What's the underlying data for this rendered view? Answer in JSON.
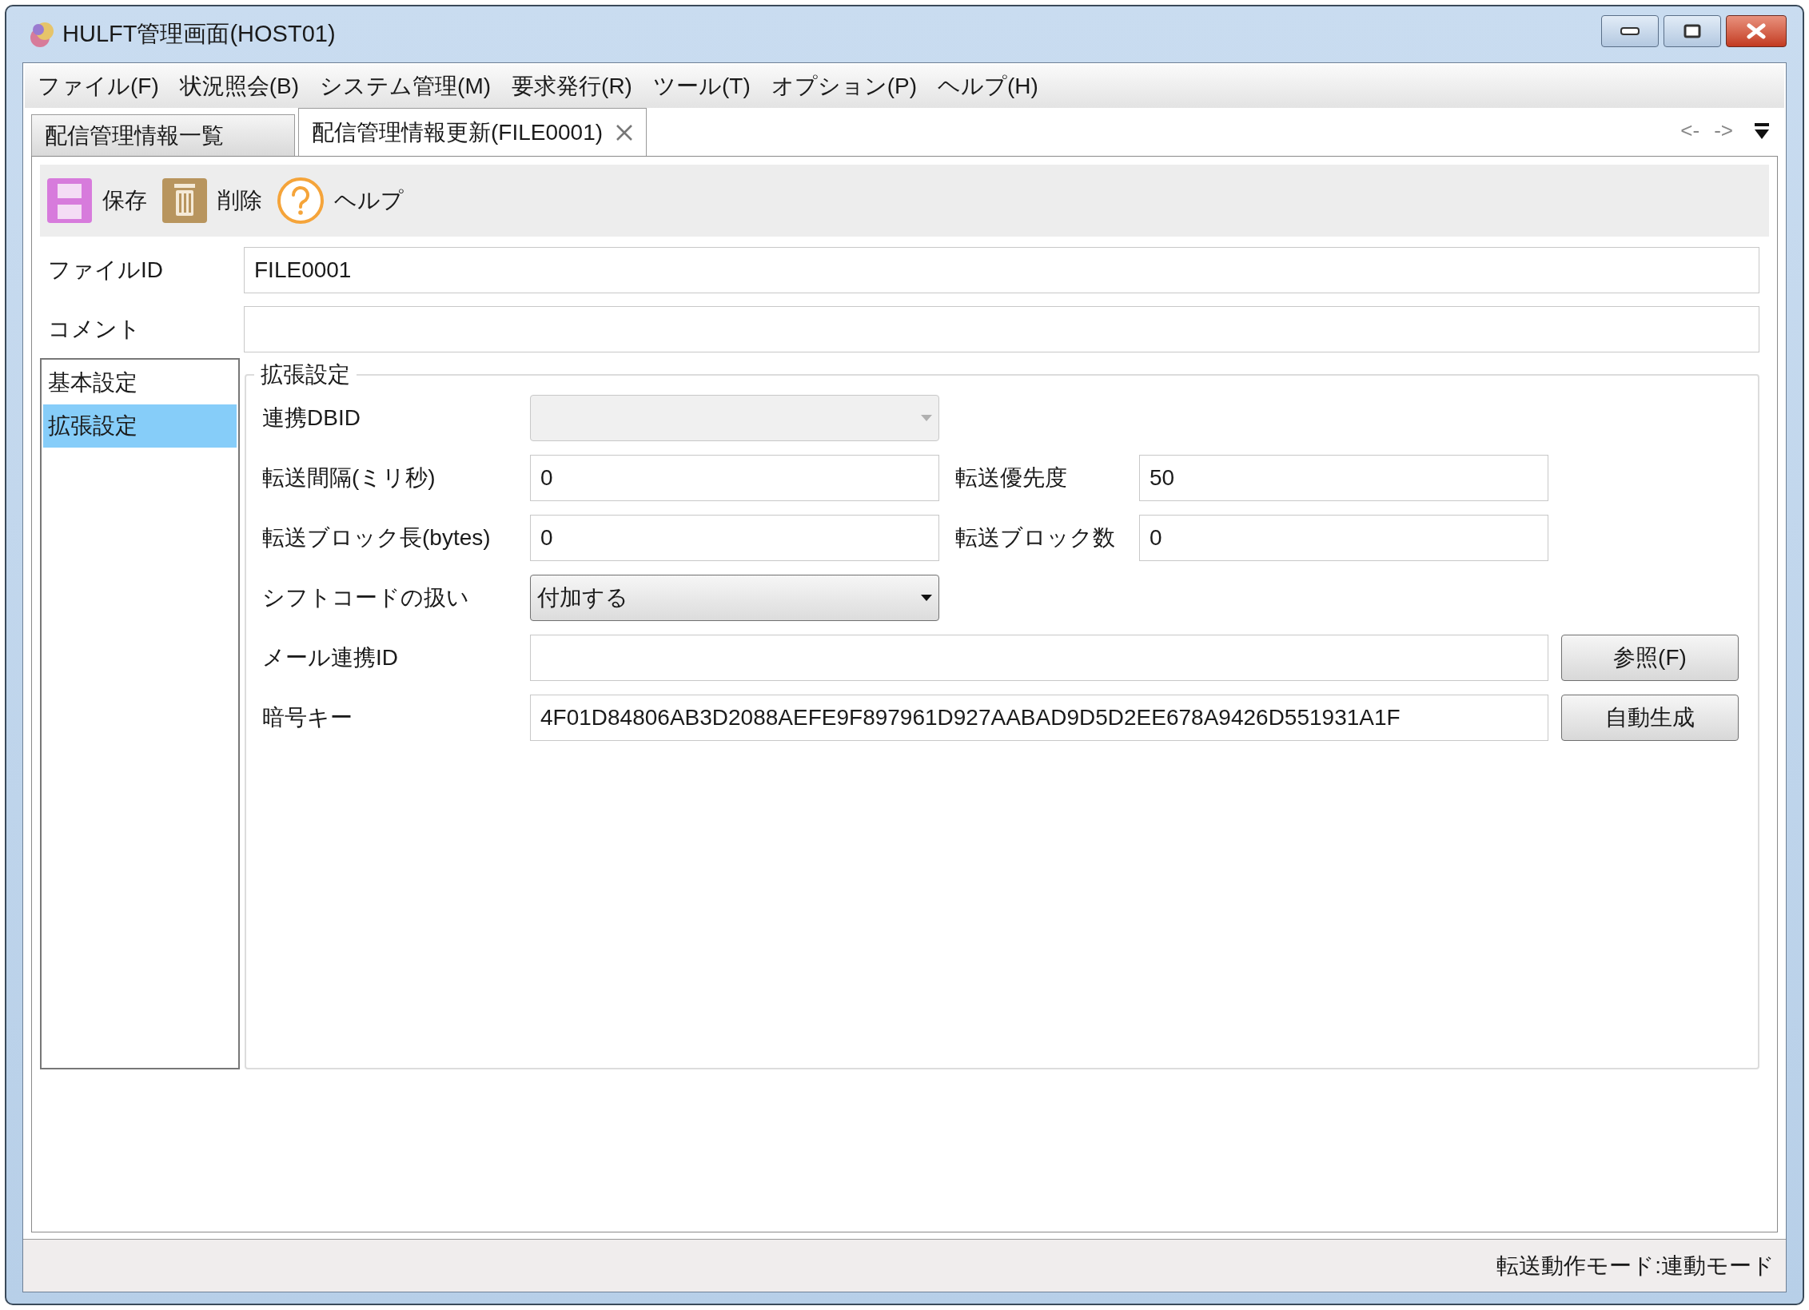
{
  "window": {
    "title": "HULFT管理画面(HOST01)"
  },
  "menu": [
    "ファイル(F)",
    "状況照会(B)",
    "システム管理(M)",
    "要求発行(R)",
    "ツール(T)",
    "オプション(P)",
    "ヘルプ(H)"
  ],
  "tabs": [
    {
      "label": "配信管理情報一覧",
      "selected": false,
      "closable": false
    },
    {
      "label": "配信管理情報更新(FILE0001)",
      "selected": true,
      "closable": true
    }
  ],
  "tab_nav": {
    "back": "<-",
    "forward": "->"
  },
  "toolbar": [
    {
      "kind": "save",
      "label": "保存"
    },
    {
      "kind": "delete",
      "label": "削除"
    },
    {
      "kind": "help",
      "label": "ヘルプ"
    }
  ],
  "file_id": {
    "label": "ファイルID",
    "value": "FILE0001"
  },
  "comment": {
    "label": "コメント"
  },
  "nav": [
    {
      "label": "基本設定",
      "selected": false
    },
    {
      "label": "拡張設定",
      "selected": true
    }
  ],
  "group": {
    "title": "拡張設定",
    "rows": [
      {
        "kind": "combo",
        "label": "連携DBID",
        "disabled": true
      },
      {
        "kind": "pair",
        "fields": [
          {
            "label": "転送間隔(ミリ秒)",
            "value": "0"
          },
          {
            "label": "転送優先度",
            "value": "50"
          }
        ]
      },
      {
        "kind": "pair",
        "fields": [
          {
            "label": "転送ブロック長(bytes)",
            "value": "0"
          },
          {
            "label": "転送ブロック数",
            "value": "0"
          }
        ]
      },
      {
        "kind": "combo",
        "label": "シフトコードの扱い",
        "value": "付加する",
        "disabled": false
      },
      {
        "kind": "button",
        "label": "メール連携ID",
        "button": "参照(F)"
      },
      {
        "kind": "button",
        "label": "暗号キー",
        "value": "4F01D84806AB3D2088AEFE9F897961D927AABAD9D5D2EE678A9426D551931A1F",
        "button": "自動生成"
      }
    ]
  },
  "status_bar": "転送動作モード:連動モード"
}
